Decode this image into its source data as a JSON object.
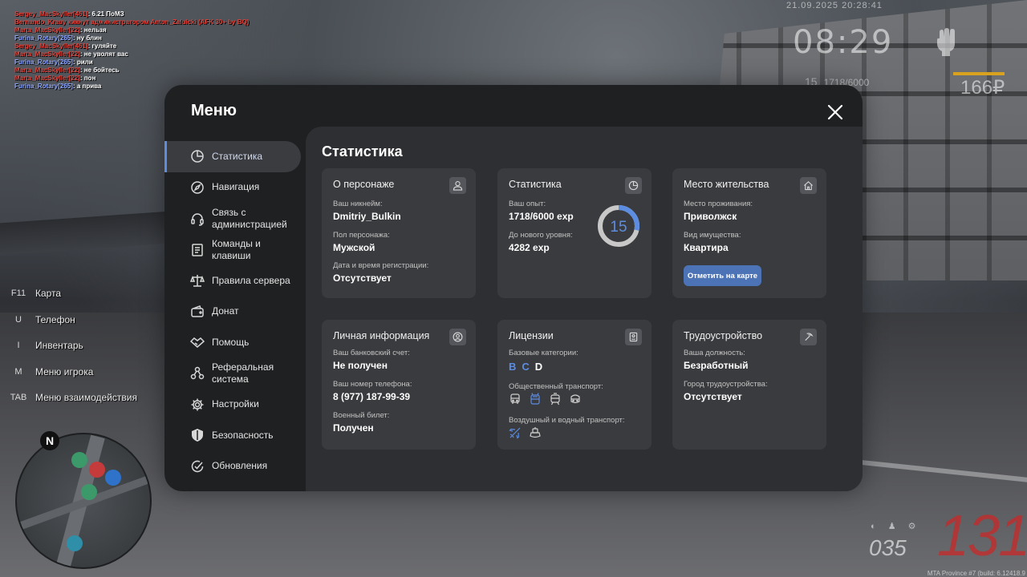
{
  "chat": [
    {
      "name": "Sergey_MacSkyller[461]",
      "name_color": "red",
      "text": "6.21 ПоМЗ"
    },
    {
      "name": "Bernando_Krauy кикнут администратором Anton_Zaluicki (AFK 30+ by BQ)",
      "name_color": "red",
      "text": ""
    },
    {
      "name": "Marta_MacSkyller[22]",
      "name_color": "red",
      "text": "нельзя"
    },
    {
      "name": "Furina_Rotary[265]",
      "name_color": "blue",
      "text": "ну блин"
    },
    {
      "name": "Sergey_MacSkyller[461]",
      "name_color": "red",
      "text": "гуляйте"
    },
    {
      "name": "Marta_MacSkyller[22]",
      "name_color": "red",
      "text": "не уволят вас"
    },
    {
      "name": "Furina_Rotary[265]",
      "name_color": "blue",
      "text": "рили"
    },
    {
      "name": "Marta_MacSkyller[22]",
      "name_color": "red",
      "text": "не бойтесь"
    },
    {
      "name": "Marta_MacSkyller[22]",
      "name_color": "red",
      "text": "пон"
    },
    {
      "name": "Furina_Rotary[265]",
      "name_color": "blue",
      "text": "а прива"
    }
  ],
  "hud": {
    "datetime": "21.09.2025 20:28:41",
    "clock": "08:29",
    "level": "15",
    "exp": "1718/6000",
    "money": "166₽",
    "fuel": "035",
    "speed": "131",
    "build": "MTA Province #7 (build: 6.12418.9"
  },
  "binds": [
    {
      "key": "F11",
      "label": "Карта"
    },
    {
      "key": "U",
      "label": "Телефон"
    },
    {
      "key": "I",
      "label": "Инвентарь"
    },
    {
      "key": "M",
      "label": "Меню игрока"
    },
    {
      "key": "TAB",
      "label": "Меню взаимодействия"
    }
  ],
  "minimap": {
    "north": "N"
  },
  "menu": {
    "title": "Меню",
    "nav": [
      {
        "id": "stats",
        "label": "Статистика",
        "icon": "pie-chart-icon",
        "active": true
      },
      {
        "id": "navigation",
        "label": "Навигация",
        "icon": "compass-icon"
      },
      {
        "id": "admin",
        "label": "Связь с администрацией",
        "icon": "headset-icon"
      },
      {
        "id": "commands",
        "label": "Команды и клавиши",
        "icon": "document-icon"
      },
      {
        "id": "rules",
        "label": "Правила сервера",
        "icon": "scales-icon"
      },
      {
        "id": "donate",
        "label": "Донат",
        "icon": "wallet-icon"
      },
      {
        "id": "help",
        "label": "Помощь",
        "icon": "handshake-icon"
      },
      {
        "id": "referral",
        "label": "Реферальная система",
        "icon": "network-icon"
      },
      {
        "id": "settings",
        "label": "Настройки",
        "icon": "gear-icon"
      },
      {
        "id": "security",
        "label": "Безопасность",
        "icon": "shield-icon"
      },
      {
        "id": "updates",
        "label": "Обновления",
        "icon": "check-circle-icon"
      }
    ],
    "content_title": "Статистика",
    "cards": {
      "character": {
        "title": "О персонаже",
        "nick_label": "Ваш никнейм:",
        "nick": "Dmitriy_Bulkin",
        "gender_label": "Пол персонажа:",
        "gender": "Мужской",
        "reg_label": "Дата и время регистрации:",
        "reg": "Отсутствует"
      },
      "stats": {
        "title": "Статистика",
        "exp_label": "Ваш опыт:",
        "exp": "1718/6000 exp",
        "next_label": "До нового уровня:",
        "next": "4282 exp",
        "level": "15",
        "progress": 0.286
      },
      "residence": {
        "title": "Место жительства",
        "place_label": "Место проживания:",
        "place": "Приволжск",
        "property_label": "Вид имущества:",
        "property": "Квартира",
        "button": "Отметить на карте"
      },
      "personal": {
        "title": "Личная информация",
        "bank_label": "Ваш банковский счет:",
        "bank": "Не получен",
        "phone_label": "Ваш номер телефона:",
        "phone": "8 (977) 187-99-39",
        "military_label": "Военный билет:",
        "military": "Получен"
      },
      "licenses": {
        "title": "Лицензии",
        "base_label": "Базовые категории:",
        "categories": [
          {
            "cat": "B",
            "owned": true
          },
          {
            "cat": "C",
            "owned": true
          },
          {
            "cat": "D",
            "owned": false
          }
        ],
        "public_label": "Общественный транспорт:",
        "air_label": "Воздушный и водный транспорт:"
      },
      "job": {
        "title": "Трудоустройство",
        "position_label": "Ваша должность:",
        "position": "Безработный",
        "city_label": "Город трудоустройства:",
        "city": "Отсутствует"
      }
    }
  },
  "colors": {
    "accent": "#5d8de1",
    "card": "#3a3b3e",
    "panel": "#2e2f32",
    "menu_bg": "#1f2022",
    "button": "#4d73b7"
  }
}
